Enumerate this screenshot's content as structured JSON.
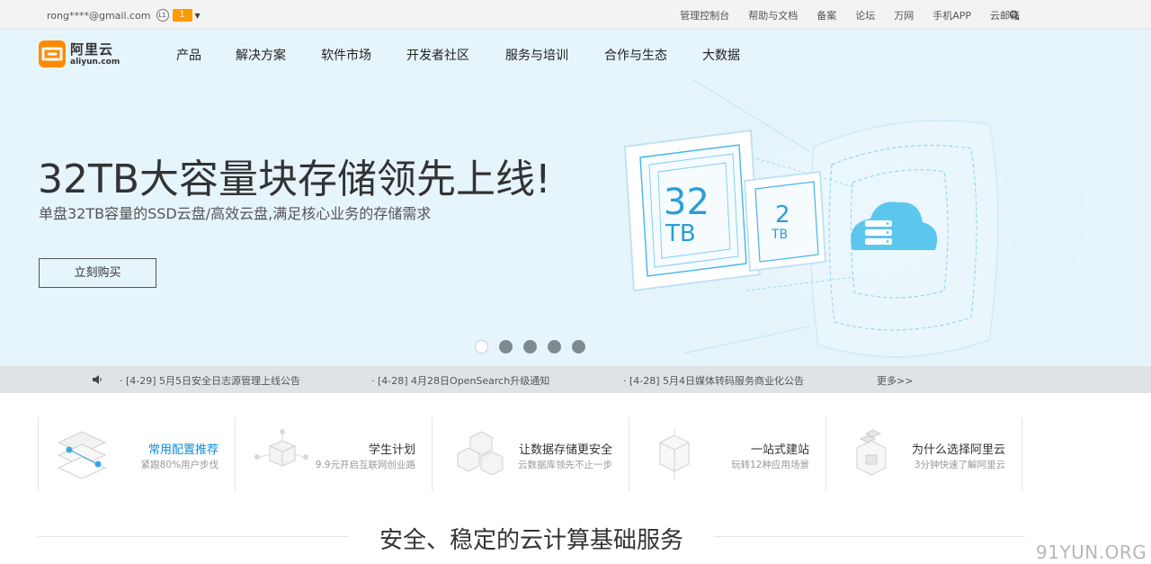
{
  "topbar": {
    "user_email": "rong****@gmail.com",
    "user_level": "L1",
    "message_count": "1",
    "links": [
      "管理控制台",
      "帮助与文档",
      "备案",
      "论坛",
      "万网",
      "手机APP",
      "云邮箱"
    ],
    "search_icon": "search-icon"
  },
  "logo": {
    "cn": "阿里云",
    "en": "aliyun.com"
  },
  "nav": {
    "items": [
      "产品",
      "解决方案",
      "软件市场",
      "开发者社区",
      "服务与培训",
      "合作与生态",
      "大数据"
    ]
  },
  "hero": {
    "title": "32TB大容量块存储领先上线!",
    "subtitle": "单盘32TB容量的SSD云盘/高效云盘,满足核心业务的存储需求",
    "button": "立刻购买",
    "big_chip": {
      "num": "32",
      "unit": "TB"
    },
    "small_chip": {
      "num": "2",
      "unit": "TB"
    },
    "slide_count": 5,
    "active_slide": 1
  },
  "notices": {
    "items": [
      "· [4-29]  5月5日安全日志源管理上线公告",
      "· [4-28]  4月28日OpenSearch升级通知",
      "· [4-28]  5月4日媒体转码服务商业化公告"
    ],
    "more": "更多>>"
  },
  "features": [
    {
      "title": "常用配置推荐",
      "subtitle": "紧跟80%用户步伐",
      "highlight": true
    },
    {
      "title": "学生计划",
      "subtitle": "9.9元开启互联网创业路",
      "highlight": false
    },
    {
      "title": "让数据存储更安全",
      "subtitle": "云数据库领先不止一步",
      "highlight": false
    },
    {
      "title": "一站式建站",
      "subtitle": "玩转12种应用场景",
      "highlight": false
    },
    {
      "title": "为什么选择阿里云",
      "subtitle": "3分钟快速了解阿里云",
      "highlight": false
    }
  ],
  "section": {
    "title": "安全、稳定的云计算基础服务"
  },
  "watermark": "91YUN.ORG",
  "colors": {
    "brand_orange": "#ff8a00",
    "accent_blue": "#0f8ed6",
    "hero_bg": "#e6f4fb"
  }
}
